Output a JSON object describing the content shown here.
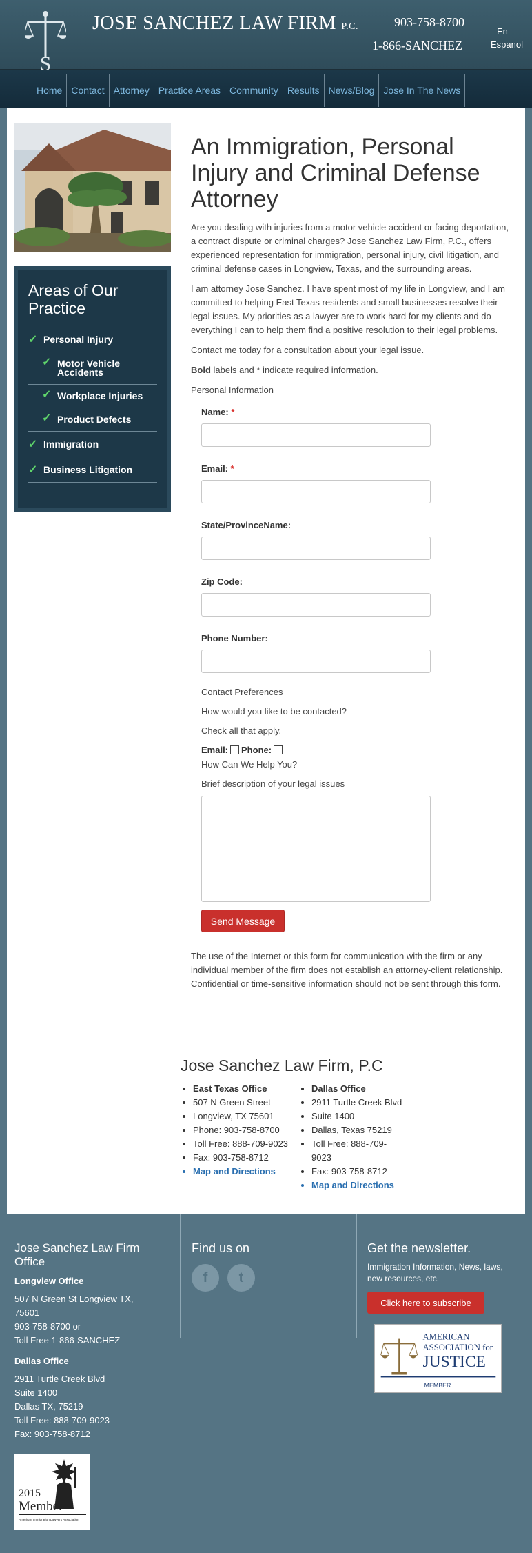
{
  "header": {
    "firm_name": "JOSE SANCHEZ LAW FIRM",
    "firm_suffix": "P.C.",
    "logo_letter": "S",
    "phone_local": "903-758-8700",
    "phone_tollfree": "1-866-SANCHEZ",
    "lang_en": "En",
    "lang_es": "Espanol"
  },
  "nav": [
    "Home",
    "Contact",
    "Attorney",
    "Practice Areas",
    "Community",
    "Results",
    "News/Blog",
    "Jose In The News"
  ],
  "sidebar": {
    "title": "Areas of Our Practice",
    "items": [
      {
        "label": "Personal Injury",
        "level": 0
      },
      {
        "label": "Motor Vehicle Accidents",
        "level": 1
      },
      {
        "label": "Workplace Injuries",
        "level": 1
      },
      {
        "label": "Product Defects",
        "level": 1
      },
      {
        "label": "Immigration",
        "level": 0
      },
      {
        "label": "Business Litigation",
        "level": 0
      }
    ]
  },
  "main": {
    "heading": "An Immigration, Personal Injury and Criminal Defense Attorney",
    "p1": "Are you dealing with injuries from a motor vehicle accident or facing deportation, a contract dispute or criminal charges? Jose Sanchez Law Firm, P.C., offers experienced representation for immigration, personal injury, civil litigation, and criminal defense cases in Longview, Texas, and the surrounding areas.",
    "p2": "I am attorney Jose Sanchez. I have spent most of my life in Longview, and I am committed to helping East Texas residents and small businesses resolve their legal issues. My priorities as a lawyer are to work hard for my clients and do everything I can to help them find a positive resolution to their legal problems.",
    "p3": "Contact me today for a consultation about your legal issue.",
    "bold_word": "Bold",
    "required_note": " labels and * indicate required information.",
    "section_personal": "Personal Information"
  },
  "form": {
    "name_label": "Name:",
    "email_label": "Email:",
    "state_label": "State/ProvinceName:",
    "zip_label": "Zip Code:",
    "phone_label": "Phone Number:",
    "required_mark": "*",
    "contact_pref": "Contact Preferences",
    "how_contact": "How would you like to be contacted?",
    "check_all": "Check all that apply.",
    "cb_email": "Email:",
    "cb_phone": "Phone:",
    "how_help": "How Can We Help You?",
    "brief_desc": "Brief description of your legal issues",
    "send": "Send Message",
    "disclaimer": "The use of the Internet or this form for communication with the firm or any individual member of the firm does not establish an attorney-client relationship. Confidential or time-sensitive information should not be sent through this form."
  },
  "offices": {
    "title": "Jose Sanchez Law Firm, P.C",
    "east": [
      "East Texas Office",
      "507 N Green Street",
      "Longview, TX 75601",
      "Phone: 903-758-8700",
      "Toll Free: 888-709-9023",
      "Fax: 903-758-8712",
      "Map and Directions"
    ],
    "dallas": [
      "Dallas Office",
      "2911 Turtle Creek Blvd",
      "Suite 1400",
      "Dallas, Texas 75219",
      "Toll Free: 888-709-9023",
      "Fax: 903-758-8712",
      "Map and Directions"
    ]
  },
  "footer": {
    "office_title": "Jose Sanchez Law Firm Office",
    "longview_title": "Longview Office",
    "longview": [
      "507 N Green St Longview TX, 75601",
      "903-758-8700 or",
      "Toll Free 1-866-SANCHEZ"
    ],
    "dallas_title": "Dallas Office",
    "dallas": [
      "2911 Turtle Creek Blvd",
      "Suite 1400",
      "Dallas TX, 75219",
      "Toll Free: 888-709-9023",
      "Fax: 903-758-8712"
    ],
    "find_us": "Find us on",
    "facebook_glyph": "f",
    "twitter_glyph": "t",
    "newsletter_title": "Get the newsletter.",
    "newsletter_text": "Immigration Information, News, laws, new resources, etc.",
    "subscribe": "Click here to subscribe",
    "aaj_line1": "AMERICAN",
    "aaj_line2": "ASSOCIATION for",
    "aaj_line3": "JUSTICE",
    "aaj_member": "MEMBER",
    "badge_year": "2015",
    "badge_member": "Member",
    "badge_org": "American Immigration Lawyers Association"
  },
  "colors": {
    "header_bg": "#3e5f6e",
    "nav_bg": "#1c3849",
    "nav_link": "#7db7dd",
    "sidebar_bg": "#1d3848",
    "check": "#5fd46b",
    "button_red": "#c9302c",
    "footer_bg": "#557484",
    "link_blue": "#2a6fb0"
  }
}
